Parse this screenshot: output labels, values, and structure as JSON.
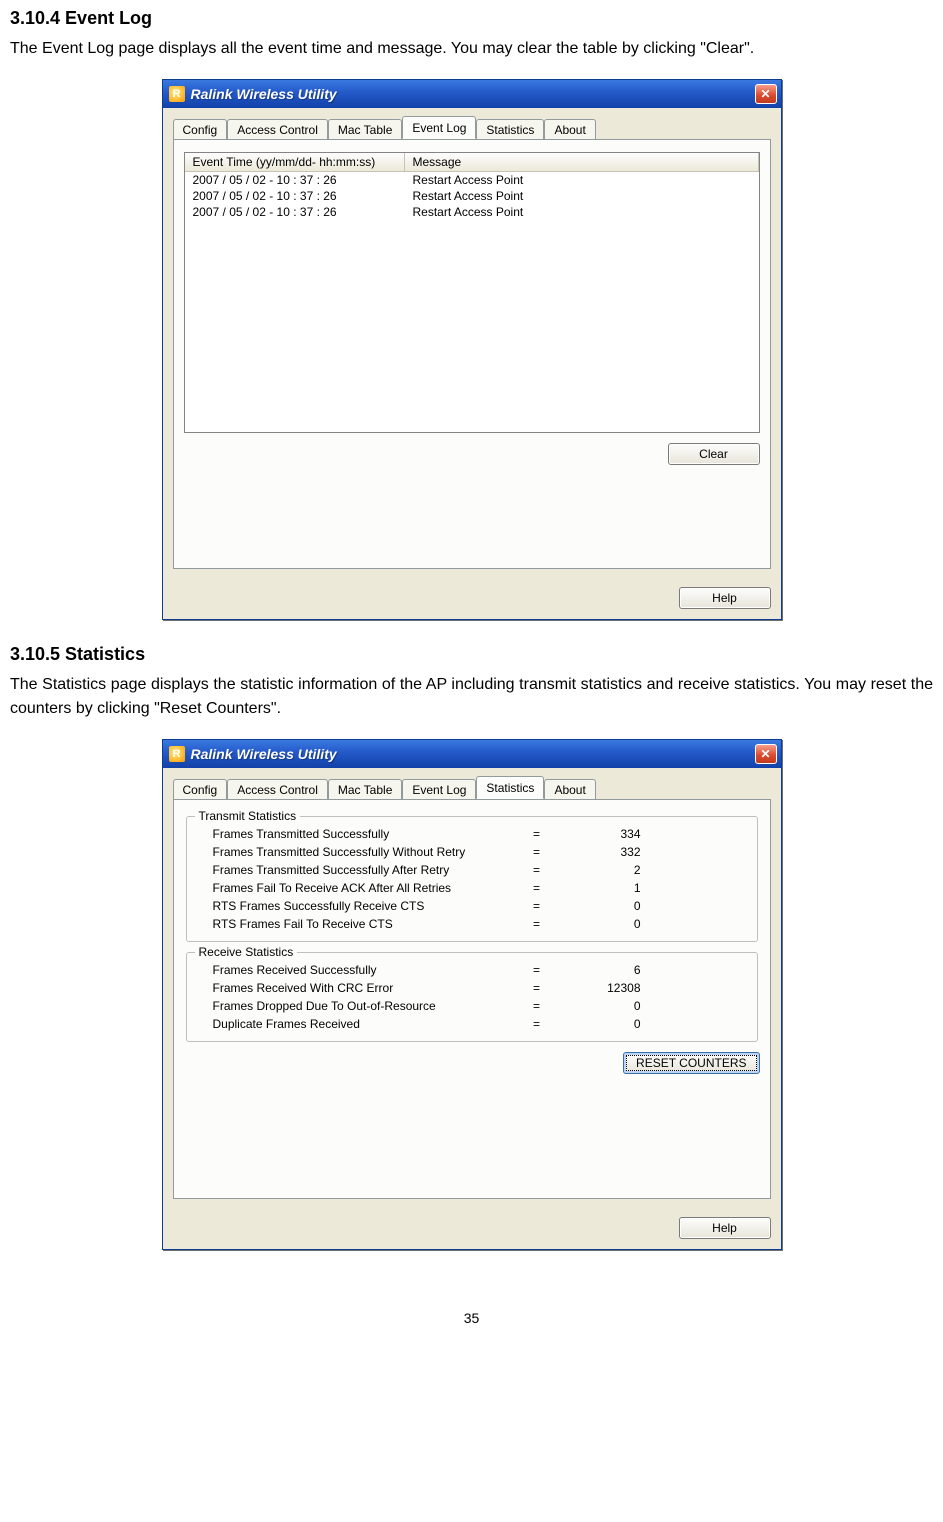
{
  "sections": {
    "eventlog": {
      "heading": "3.10.4 Event Log",
      "body": "The Event Log page displays all the event time and message. You may clear the table by clicking \"Clear\"."
    },
    "statistics": {
      "heading": "3.10.5 Statistics",
      "body": "The Statistics page displays the statistic information of the AP including transmit statistics and receive statistics. You may reset the counters by clicking \"Reset Counters\"."
    }
  },
  "window": {
    "title": "Ralink Wireless Utility",
    "tabs": [
      "Config",
      "Access Control",
      "Mac Table",
      "Event Log",
      "Statistics",
      "About"
    ],
    "help_label": "Help"
  },
  "eventlog": {
    "columns": {
      "time": "Event Time (yy/mm/dd- hh:mm:ss)",
      "message": "Message"
    },
    "rows": [
      {
        "time": "2007 / 05 / 02 - 10 : 37 : 26",
        "message": "Restart Access Point"
      },
      {
        "time": "2007 / 05 / 02 - 10 : 37 : 26",
        "message": "Restart Access Point"
      },
      {
        "time": "2007 / 05 / 02 - 10 : 37 : 26",
        "message": "Restart Access Point"
      }
    ],
    "clear_label": "Clear"
  },
  "statistics": {
    "transmit": {
      "legend": "Transmit Statistics",
      "rows": [
        {
          "label": "Frames Transmitted Successfully",
          "value": "334"
        },
        {
          "label": "Frames Transmitted Successfully  Without Retry",
          "value": "332"
        },
        {
          "label": "Frames Transmitted Successfully After Retry",
          "value": "2"
        },
        {
          "label": "Frames Fail To Receive ACK After All Retries",
          "value": "1"
        },
        {
          "label": "RTS Frames Successfully Receive CTS",
          "value": "0"
        },
        {
          "label": "RTS Frames Fail To Receive CTS",
          "value": "0"
        }
      ]
    },
    "receive": {
      "legend": "Receive Statistics",
      "rows": [
        {
          "label": "Frames Received Successfully",
          "value": "6"
        },
        {
          "label": "Frames Received With CRC Error",
          "value": "12308"
        },
        {
          "label": "Frames Dropped Due To Out-of-Resource",
          "value": "0"
        },
        {
          "label": "Duplicate Frames Received",
          "value": "0"
        }
      ]
    },
    "reset_label": "RESET COUNTERS"
  },
  "page_number": "35"
}
